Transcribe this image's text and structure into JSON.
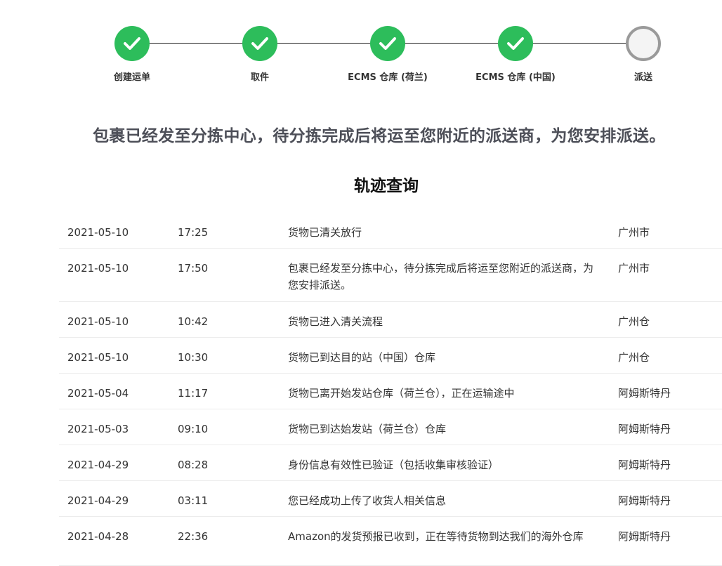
{
  "stepper": {
    "steps": [
      {
        "label": "创建运单",
        "status": "done"
      },
      {
        "label": "取件",
        "status": "done"
      },
      {
        "label": "ECMS 仓库 (荷兰)",
        "status": "done"
      },
      {
        "label": "ECMS 仓库 (中国)",
        "status": "done"
      },
      {
        "label": "派送",
        "status": "pending"
      }
    ]
  },
  "headline": "包裹已经发至分拣中心，待分拣完成后将运至您附近的派送商，为您安排派送。",
  "tracking": {
    "title": "轨迹查询",
    "rows": [
      {
        "date": "2021-05-10",
        "time": "17:25",
        "desc": "货物已清关放行",
        "location": "广州市"
      },
      {
        "date": "2021-05-10",
        "time": "17:50",
        "desc": "包裹已经发至分拣中心，待分拣完成后将运至您附近的派送商，为您安排派送。",
        "location": "广州市"
      },
      {
        "date": "2021-05-10",
        "time": "10:42",
        "desc": "货物已进入清关流程",
        "location": "广州仓"
      },
      {
        "date": "2021-05-10",
        "time": "10:30",
        "desc": "货物已到达目的站（中国）仓库",
        "location": "广州仓"
      },
      {
        "date": "2021-05-04",
        "time": "11:17",
        "desc": "货物已离开始发站仓库（荷兰仓），正在运输途中",
        "location": "阿姆斯特丹"
      },
      {
        "date": "2021-05-03",
        "time": "09:10",
        "desc": "货物已到达始发站（荷兰仓）仓库",
        "location": "阿姆斯特丹"
      },
      {
        "date": "2021-04-29",
        "time": "08:28",
        "desc": "身份信息有效性已验证（包括收集审核验证）",
        "location": "阿姆斯特丹"
      },
      {
        "date": "2021-04-29",
        "time": "03:11",
        "desc": "您已经成功上传了收货人相关信息",
        "location": "阿姆斯特丹"
      },
      {
        "date": "2021-04-28",
        "time": "22:36",
        "desc": "Amazon的发货预报已收到，正在等待货物到达我们的海外仓库",
        "location": "阿姆斯特丹"
      }
    ]
  },
  "colors": {
    "done": "#2dbd5b",
    "pending_border": "#9a9a9a",
    "headline": "#4d4f58"
  }
}
